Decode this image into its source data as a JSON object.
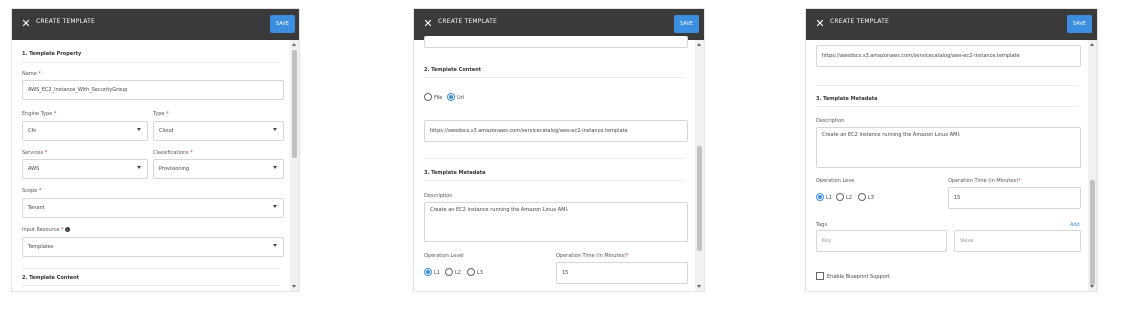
{
  "header": {
    "title": "CREATE TEMPLATE",
    "save_label": "SAVE",
    "close_glyph": "✕"
  },
  "section1": {
    "title": "1. Template Property",
    "name_label": "Name",
    "name_value": "AWS_EC2_Instance_With_SecurityGroup",
    "engine_label": "Engine Type",
    "engine_value": "Cfn",
    "type_label": "Type",
    "type_value": "Cloud",
    "services_label": "Services",
    "services_value": "AWS",
    "class_label": "Classifications",
    "class_value": "Provisioning",
    "scope_label": "Scope",
    "scope_value": "Tenant",
    "input_label": "Input Resource",
    "input_value": "Templates"
  },
  "section2": {
    "title": "2. Template Content",
    "file_label": "File",
    "url_label": "Url",
    "url_value": "https://awsdocs.s3.amazonaws.com/servicecatalog/aws-ec2-instance.template"
  },
  "section3": {
    "title": "3. Template Metadata",
    "desc_label": "Description",
    "desc_value": "Create an EC2 instance running the Amazon Linux AMI.",
    "oplevel_label_p2": "Operation Level",
    "oplevel_label_p3": "Operation Leve",
    "levels": [
      "L1",
      "L2",
      "L3"
    ],
    "optime_label": "Operation Time (in Minutes)",
    "optime_value": "15",
    "tags_label": "Tags",
    "add_label": "Add",
    "key_placeholder": "Key",
    "value_placeholder": "Value",
    "blueprint_label": "Enable Blueprint Support"
  },
  "required_mark": "*",
  "colors": {
    "header": "#3a3a3a",
    "accent": "#3c8ee0"
  }
}
